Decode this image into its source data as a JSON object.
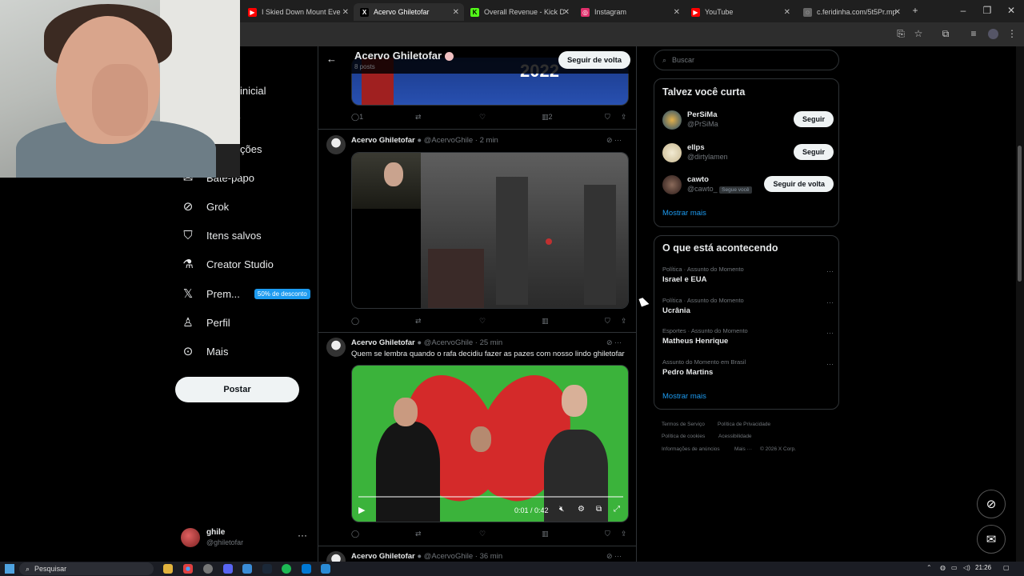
{
  "browser": {
    "tabs": [
      {
        "label": "I Skied Down Mount Eve",
        "icon": "youtube-icon",
        "color": "#ff0000",
        "active": false
      },
      {
        "label": "Acervo Ghiletofar",
        "icon": "x-icon",
        "color": "#000000",
        "active": true
      },
      {
        "label": "Overall Revenue - Kick D",
        "icon": "kick-icon",
        "color": "#53fc18",
        "active": false
      },
      {
        "label": "Instagram",
        "icon": "instagram-icon",
        "color": "#e1306c",
        "active": false
      },
      {
        "label": "YouTube",
        "icon": "youtube-icon",
        "color": "#ff0000",
        "active": false
      },
      {
        "label": "c.feridinha.com/5t5Pr.mp",
        "icon": "globe-icon",
        "color": "#888888",
        "active": false
      }
    ],
    "new_tab": "+"
  },
  "nav": {
    "items": [
      {
        "label": "Página Inicial",
        "icon": "home-icon",
        "visible": "inicial"
      },
      {
        "label": "Explorar",
        "icon": "search-icon",
        "visible": "r"
      },
      {
        "label": "Notificações",
        "icon": "bell-icon",
        "visible": "ções"
      },
      {
        "label": "Bate-papo",
        "icon": "chat-icon",
        "visible": "Bate-papo"
      },
      {
        "label": "Grok",
        "icon": "grok-icon",
        "visible": "Grok"
      },
      {
        "label": "Itens salvos",
        "icon": "bookmark-icon",
        "visible": "Itens salvos"
      },
      {
        "label": "Creator Studio",
        "icon": "flask-icon",
        "visible": "Creator Studio"
      },
      {
        "label": "Prem...",
        "icon": "x-logo-icon",
        "visible": "Prem..."
      },
      {
        "label": "Perfil",
        "icon": "person-icon",
        "visible": "Perfil"
      },
      {
        "label": "Mais",
        "icon": "more-circle-icon",
        "visible": "Mais"
      }
    ],
    "premium_badge": "50% de desconto",
    "post_button": "Postar",
    "user": {
      "name": "ghile",
      "handle": "@ghiletofar",
      "more": "···"
    }
  },
  "profile": {
    "title": "Acervo Ghiletofar",
    "posts": "8 posts",
    "follow_back": "Seguir de volta",
    "banner_text": "2022"
  },
  "tweets": [
    {
      "replies": "1",
      "views": "2"
    },
    {
      "name": "Acervo Ghiletofar",
      "handle": "@AcervoGhile",
      "time": "2 min"
    },
    {
      "name": "Acervo Ghiletofar",
      "handle": "@AcervoGhile",
      "time": "25 min",
      "text": "Quem se lembra quando o rafa decidiu fazer as pazes com nosso lindo ghiletofar",
      "video_time": "0:01 / 0:42"
    },
    {
      "name": "Acervo Ghiletofar",
      "handle": "@AcervoGhile",
      "time": "36 min"
    }
  ],
  "search": {
    "placeholder": "Buscar"
  },
  "who_to_follow": {
    "title": "Talvez você curta",
    "accounts": [
      {
        "name": "PerSiMa",
        "handle": "@PrSiMa",
        "button": "Seguir",
        "tag": ""
      },
      {
        "name": "ellps",
        "handle": "@dirtylamen",
        "button": "Seguir",
        "tag": ""
      },
      {
        "name": "cawto",
        "handle": "@cawto_",
        "button": "Seguir de volta",
        "tag": "Segue você"
      }
    ],
    "show_more": "Mostrar mais"
  },
  "trends": {
    "title": "O que está acontecendo",
    "items": [
      {
        "context": "Política · Assunto do Momento",
        "topic": "Israel e EUA"
      },
      {
        "context": "Política · Assunto do Momento",
        "topic": "Ucrânia"
      },
      {
        "context": "Esportes · Assunto do Momento",
        "topic": "Matheus Henrique"
      },
      {
        "context": "Assunto do Momento em Brasil",
        "topic": "Pedro Martins"
      }
    ],
    "show_more": "Mostrar mais"
  },
  "footer": {
    "terms": "Termos de Serviço",
    "privacy": "Política de Privacidade",
    "cookies": "Política de cookies",
    "accessibility": "Acessibilidade",
    "ads": "Informações de anúncios",
    "more": "Mais ···",
    "copyright": "© 2026 X Corp."
  },
  "taskbar": {
    "search": "Pesquisar",
    "time": "21:26"
  }
}
